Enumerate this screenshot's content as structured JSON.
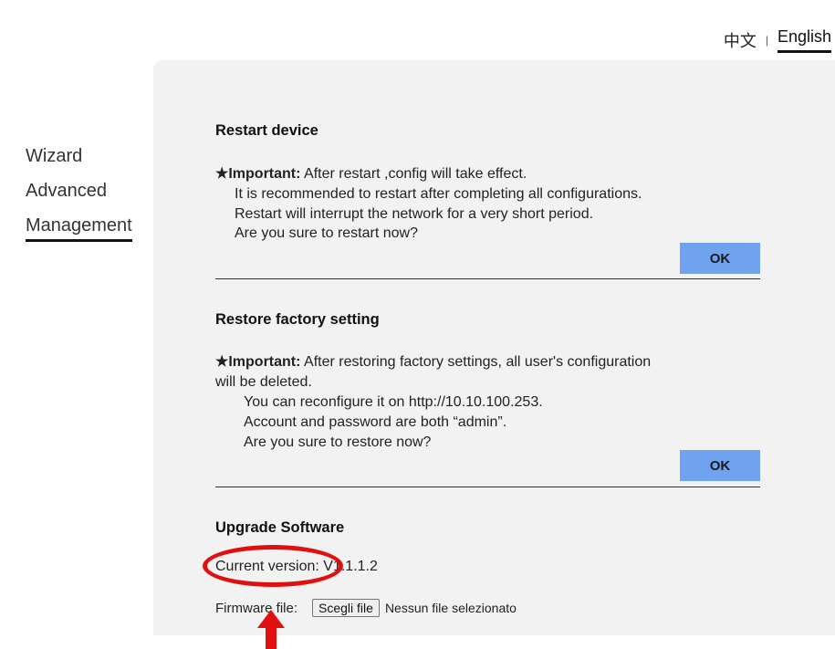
{
  "lang": {
    "chinese": "中文",
    "separator": "|",
    "english": "English"
  },
  "sidebar": {
    "items": [
      {
        "label": "Wizard"
      },
      {
        "label": "Advanced"
      },
      {
        "label": "Management"
      }
    ]
  },
  "restart": {
    "title": "Restart device",
    "important_label": "★Important:",
    "line1": " After restart ,config will take effect.",
    "line2": "It is recommended to restart after completing all configurations.",
    "line3": "Restart will interrupt the network for a very short period.",
    "line4": "Are you sure to restart now?",
    "ok_label": "OK"
  },
  "restore": {
    "title": "Restore factory setting",
    "important_label": "★Important:",
    "line1": " After restoring factory settings,  all user's configuration",
    "line1b": "will be deleted.",
    "line2": "You can reconfigure it on http://10.10.100.253.",
    "line3": "Account and password are both “admin”.",
    "line4": "Are you sure to restore now?",
    "ok_label": "OK"
  },
  "upgrade": {
    "title": "Upgrade Software",
    "current_version_label": "Current version:",
    "current_version_value": "V1.1.1.2",
    "firmware_label": "Firmware file:",
    "choose_file_label": "Scegli file",
    "no_file_label": "Nessun file selezionato"
  },
  "colors": {
    "accent_button": "#6fa3ef",
    "annotation": "#e01010",
    "panel_bg": "#f2f2f2"
  },
  "icons": {
    "annotation_arrow": "red-arrow-up-icon",
    "annotation_circle": "red-ellipse-icon"
  }
}
